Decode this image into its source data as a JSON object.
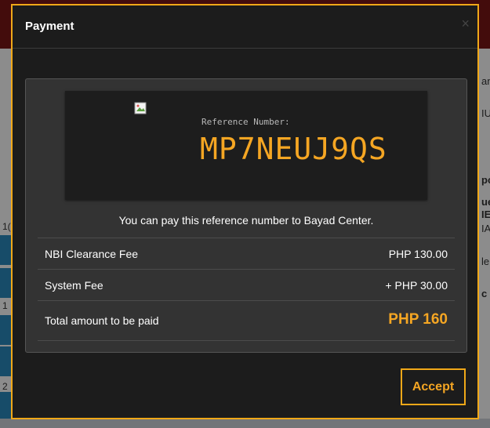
{
  "modal": {
    "title": "Payment",
    "close_symbol": "×"
  },
  "reference": {
    "label": "Reference Number:",
    "number": "MP7NEUJ9QS",
    "logo_icon": "broken-image-icon"
  },
  "pay_note": "You can pay this reference number to Bayad Center.",
  "fees": [
    {
      "label": "NBI Clearance Fee",
      "value": "PHP 130.00"
    },
    {
      "label": "System Fee",
      "value": "+ PHP 30.00"
    }
  ],
  "total": {
    "label": "Total amount to be paid",
    "value": "PHP 160"
  },
  "actions": {
    "accept_label": "Accept"
  },
  "background_fragments": {
    "right": [
      "an",
      "IU",
      "po",
      "ue",
      "IE",
      "IA",
      "le",
      "c"
    ],
    "left": [
      "1(",
      "1",
      "2"
    ]
  },
  "colors": {
    "accent": "#f5a623",
    "modal_bg": "#1c1c1c",
    "panel_bg": "#333333",
    "header_bar": "#7a1616"
  }
}
